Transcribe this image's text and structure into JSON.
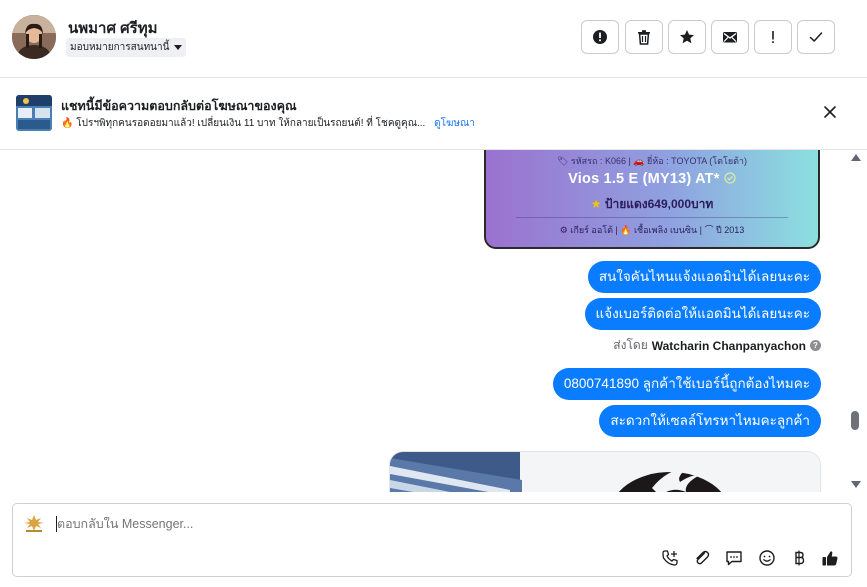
{
  "header": {
    "contact_name": "นพมาศ ศรีทุม",
    "assign_label": "มอบหมายการสนทนานี้",
    "icons": [
      "alert-circle-icon",
      "trash-icon",
      "star-icon",
      "envelope-icon",
      "exclamation-icon",
      "check-icon"
    ]
  },
  "ad_banner": {
    "title": "แชทนี้มีข้อความตอบกลับต่อโฆษณาของคุณ",
    "subtitle": "โปรฯพิทุกคนรอดอยมาแล้ว! เปลี่ยนเงิน 11 บาท ให้กลายเป็นรถยนต์! ที่ โชคดูคุณ...",
    "link_label": "ดูโฆษณา",
    "fire_emoji": "🔥"
  },
  "ad_card": {
    "line1": "🏷 รหัสรถ : K066 | 🚗 ยี่ห้อ : TOYOTA (โตโยต้า)",
    "model": "Vios 1.5 E (MY13) AT*",
    "price": "ป้ายแดง649,000บาท",
    "specs": "⚙ เกียร์ ออโต้  |  🔥 เชื้อเพลิง เบนซิน  |  ⌒ ปี 2013"
  },
  "messages": [
    {
      "text": "สนใจคันไหนแจ้งแอดมินได้เลยนะคะ"
    },
    {
      "text": "แจ้งเบอร์ติดต่อให้แอดมินได้เลยนะคะ"
    },
    {
      "text": "0800741890  ลูกค้าใช้เบอร์นี้ถูกต้องไหมคะ"
    },
    {
      "text": "สะดวกให้เซลล์โทรหาไหมคะลูกค้า"
    }
  ],
  "sent_by": {
    "prefix": "ส่งโดย",
    "name": "Watcharin Chanpanyachon",
    "help": "?"
  },
  "composer": {
    "placeholder": "ตอบกลับใน Messenger...",
    "tools": [
      "phone-add-icon",
      "attach-icon",
      "saved-reply-icon",
      "emoji-icon",
      "baht-icon",
      "thumbs-up-icon"
    ]
  },
  "colors": {
    "bubble": "#0a7cff",
    "link": "#1877f2",
    "border": "#ccd0d5"
  }
}
